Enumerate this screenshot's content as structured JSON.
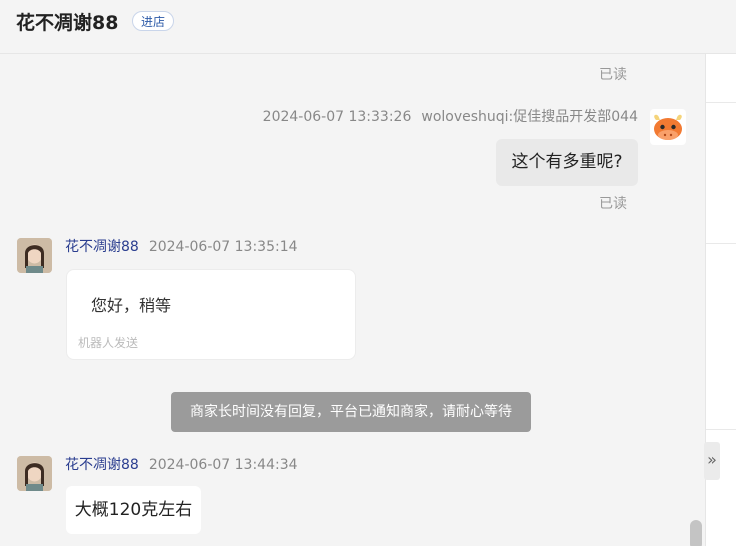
{
  "header": {
    "shop_name": "花不凋谢88",
    "enter_store_label": "进店"
  },
  "messages": {
    "read_top": "已读",
    "outgoing": {
      "time": "2024-06-07 13:33:26",
      "sender": "woloveshuqi:促佳搜品开发部044",
      "text": "这个有多重呢?",
      "read": "已读"
    },
    "incoming1": {
      "sender": "花不凋谢88",
      "time": "2024-06-07 13:35:14",
      "text": "您好，稍等",
      "note": "机器人发送"
    },
    "system_notice": "商家长时间没有回复，平台已通知商家，请耐心等待",
    "incoming2": {
      "sender": "花不凋谢88",
      "time": "2024-06-07 13:44:34",
      "text": "大概120克左右"
    }
  },
  "icons": {
    "expand": "chevron-double-right-icon"
  },
  "colors": {
    "accent_blue": "#2d5ba8",
    "sender_name": "#2a3d8f",
    "system_notice_bg": "#9b9b9b",
    "avatar_orange": "#f27a32"
  }
}
